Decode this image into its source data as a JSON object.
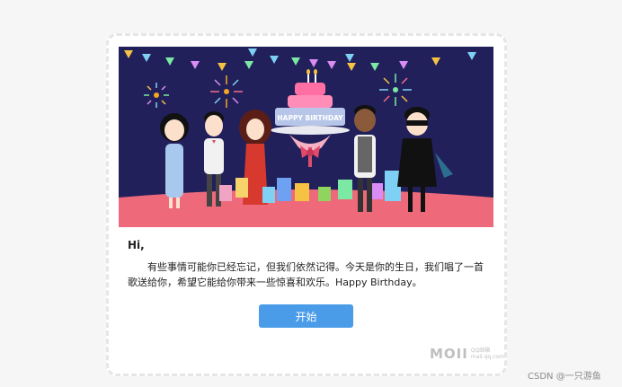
{
  "banner": {
    "cake_text": "HAPPY BIRTHDAY",
    "colors": {
      "background": "#22205b",
      "floor": "#ee6a7a",
      "cake_pink": "#ff6fa3",
      "cake_blue": "#b7c6e8"
    }
  },
  "message": {
    "greeting": "Hi,",
    "body": "有些事情可能你已经忘记，但我们依然记得。今天是你的生日，我们唱了一首歌送给你，希望它能给你带来一些惊喜和欢乐。Happy Birthday。"
  },
  "start_button": {
    "label": "开始"
  },
  "brand": {
    "logo": "MOII",
    "sub_top": "QQ邮箱",
    "sub_bottom": "mail.qq.com"
  },
  "watermark": "CSDN @一只游鱼"
}
